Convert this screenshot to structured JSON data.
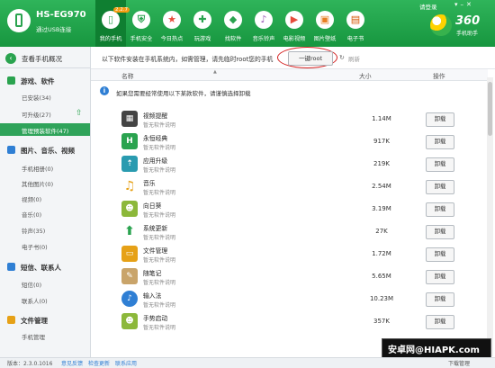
{
  "device": {
    "name": "HS-EG970",
    "connection": "通过USB连接"
  },
  "header": {
    "login": "请登录"
  },
  "nav": [
    {
      "label": "我的手机",
      "icon": "phone-icon",
      "badge": "2.2.7"
    },
    {
      "label": "手机安全",
      "icon": "shield-icon"
    },
    {
      "label": "今日热点",
      "icon": "star-icon"
    },
    {
      "label": "玩游戏",
      "icon": "gamepad-icon"
    },
    {
      "label": "找软件",
      "icon": "bag-icon"
    },
    {
      "label": "音乐铃声",
      "icon": "music-icon"
    },
    {
      "label": "电影视频",
      "icon": "video-icon"
    },
    {
      "label": "图片壁纸",
      "icon": "picture-icon"
    },
    {
      "label": "电子书",
      "icon": "book-icon"
    }
  ],
  "logo": {
    "text": "360",
    "subtext": "手机助手"
  },
  "sidebar": {
    "back_label": "查看手机概况",
    "sections": [
      {
        "title": "游戏、软件",
        "items": [
          {
            "label": "已安装(34)"
          },
          {
            "label": "可升级(27)"
          },
          {
            "label": "管理预装软件(47)"
          }
        ]
      },
      {
        "title": "图片、音乐、视频",
        "items": [
          {
            "label": "手机相册(0)"
          },
          {
            "label": "其他图片(0)"
          },
          {
            "label": "视频(0)"
          },
          {
            "label": "音乐(0)"
          },
          {
            "label": "铃声(35)"
          },
          {
            "label": "电子书(0)"
          }
        ]
      },
      {
        "title": "短信、联系人",
        "items": [
          {
            "label": "短信(0)"
          },
          {
            "label": "联系人(0)"
          }
        ]
      },
      {
        "title": "文件管理",
        "items": [
          {
            "label": "手机管理"
          }
        ]
      }
    ]
  },
  "toolbar": {
    "text": "以下软件安装在手机系统内，如需管理，请先临时root您的手机",
    "root_button": "一键root",
    "refresh": "刷新"
  },
  "table": {
    "headers": {
      "name": "名称",
      "size": "大小",
      "action": "操作"
    },
    "notice": "如果您需要经常使用以下某款软件，请谨慎选择卸载",
    "rows": [
      {
        "name": "视频提醒",
        "desc": "暂无软件说明",
        "size": "1.14M",
        "action": "卸载",
        "icon": "video-reminder-icon",
        "color": "#444444"
      },
      {
        "name": "永恒经典",
        "desc": "暂无软件说明",
        "size": "917K",
        "action": "卸载",
        "icon": "classic-icon",
        "color": "#2aa34f"
      },
      {
        "name": "应用升级",
        "desc": "暂无软件说明",
        "size": "219K",
        "action": "卸载",
        "icon": "app-upgrade-icon",
        "color": "#2a9bb0"
      },
      {
        "name": "音乐",
        "desc": "暂无软件说明",
        "size": "2.54M",
        "action": "卸载",
        "icon": "music-note-icon",
        "color": "#e6a117"
      },
      {
        "name": "向日葵",
        "desc": "暂无软件说明",
        "size": "3.19M",
        "action": "卸载",
        "icon": "android-icon",
        "color": "#8cb83a"
      },
      {
        "name": "系统更新",
        "desc": "暂无软件说明",
        "size": "27K",
        "action": "卸载",
        "icon": "system-update-icon",
        "color": "#2aa34f"
      },
      {
        "name": "文件管理",
        "desc": "暂无软件说明",
        "size": "1.72M",
        "action": "卸载",
        "icon": "folder-icon",
        "color": "#e6a117"
      },
      {
        "name": "随笔记",
        "desc": "暂无软件说明",
        "size": "5.65M",
        "action": "卸载",
        "icon": "notes-icon",
        "color": "#c9a46a"
      },
      {
        "name": "输入法",
        "desc": "暂无软件说明",
        "size": "10.23M",
        "action": "卸载",
        "icon": "input-method-icon",
        "color": "#2f7fd4"
      },
      {
        "name": "手势启动",
        "desc": "暂无软件说明",
        "size": "357K",
        "action": "卸载",
        "icon": "gesture-launch-icon",
        "color": "#8cb83a"
      }
    ]
  },
  "status": {
    "version": "版本：2.3.0.1016",
    "links": [
      "意见反馈",
      "检查更新",
      "联系应用"
    ],
    "right": "下载管理"
  },
  "watermark": "安卓网@HIAPK.com",
  "colors": {
    "brand": "#2fb45a",
    "active": "#0f7f31"
  }
}
